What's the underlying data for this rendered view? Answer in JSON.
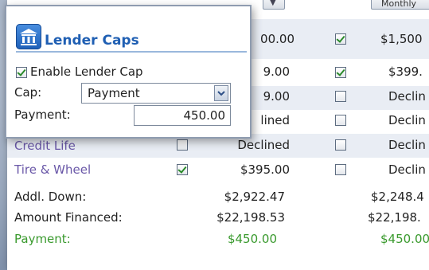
{
  "popup": {
    "title": "Lender Caps",
    "enable_label": "Enable Lender Cap",
    "enable_checked": true,
    "cap_label": "Cap:",
    "cap_value": "Payment",
    "payment_label": "Payment:",
    "payment_value": "450.00"
  },
  "header": {
    "monthly_label": "Monthly"
  },
  "rows": [
    {
      "label": "",
      "col1_checked": null,
      "col1_value": "00.00",
      "col2_checked": true,
      "col2_value": "$1,500"
    },
    {
      "label": "",
      "col1_checked": null,
      "col1_value": "9.00",
      "col2_checked": true,
      "col2_value": "$399."
    },
    {
      "label": "",
      "col1_checked": null,
      "col1_value": "9.00",
      "col2_checked": false,
      "col2_value": "Declin"
    },
    {
      "label": "",
      "col1_checked": null,
      "col1_value": "lined",
      "col2_checked": false,
      "col2_value": "Declin"
    },
    {
      "label": "Credit Life",
      "col1_checked": false,
      "col1_value": "Declined",
      "col2_checked": false,
      "col2_value": "Declin"
    },
    {
      "label": "Tire & Wheel",
      "col1_checked": true,
      "col1_value": "$395.00",
      "col2_checked": false,
      "col2_value": "Declin"
    }
  ],
  "summary": [
    {
      "label": "Addl. Down:",
      "col1": "$2,922.47",
      "col2": "$2,248.4"
    },
    {
      "label": "Amount Financed:",
      "col1": "$22,198.53",
      "col2": "$22,198."
    },
    {
      "label": "Payment:",
      "col1": "$450.00",
      "col2": "$450.00"
    }
  ],
  "colors": {
    "accent_blue": "#1f5fb3",
    "link_purple": "#6a58a8",
    "payment_green": "#3a9a2e"
  }
}
